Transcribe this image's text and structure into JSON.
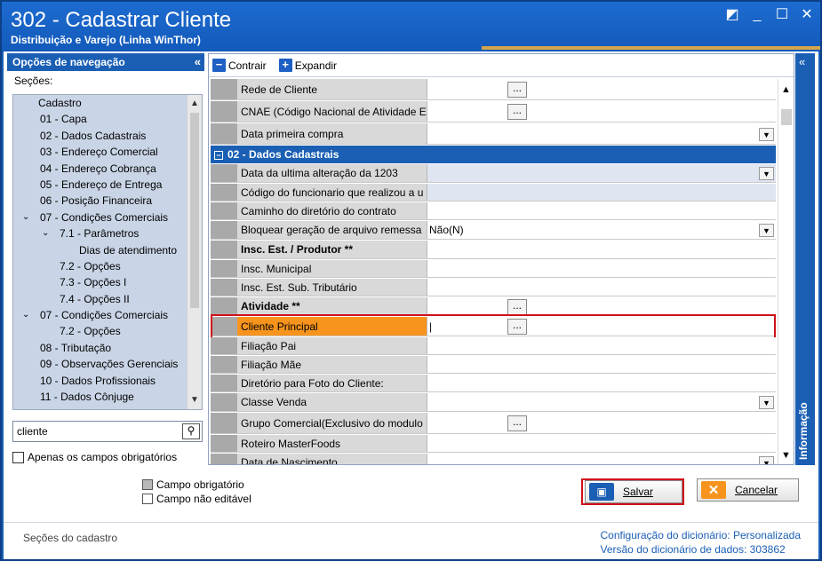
{
  "window": {
    "title": "302 - Cadastrar Cliente",
    "subtitle": "Distribuição e Varejo (Linha WinThor)"
  },
  "nav": {
    "header": "Opções de navegação",
    "collapse": "«",
    "sections_label": "Seções:",
    "items": [
      {
        "label": "Cadastro",
        "indent": 0,
        "expander": ""
      },
      {
        "label": "01 - Capa",
        "indent": 1,
        "expander": ""
      },
      {
        "label": "02 - Dados Cadastrais",
        "indent": 1,
        "expander": ""
      },
      {
        "label": "03 - Endereço Comercial",
        "indent": 1,
        "expander": ""
      },
      {
        "label": "04 - Endereço Cobrança",
        "indent": 1,
        "expander": ""
      },
      {
        "label": "05 - Endereço de Entrega",
        "indent": 1,
        "expander": ""
      },
      {
        "label": "06 - Posição Financeira",
        "indent": 1,
        "expander": ""
      },
      {
        "label": "07 - Condições Comerciais",
        "indent": 1,
        "expander": "v"
      },
      {
        "label": "7.1 - Parâmetros",
        "indent": 2,
        "expander": "v"
      },
      {
        "label": "Dias de atendimento",
        "indent": 3,
        "expander": ""
      },
      {
        "label": "7.2 - Opções",
        "indent": 2,
        "expander": ""
      },
      {
        "label": "7.3 - Opções I",
        "indent": 2,
        "expander": ""
      },
      {
        "label": "7.4 - Opções II",
        "indent": 2,
        "expander": ""
      },
      {
        "label": "07 - Condições Comerciais",
        "indent": 1,
        "expander": "v"
      },
      {
        "label": "7.2 - Opções",
        "indent": 2,
        "expander": ""
      },
      {
        "label": "08 - Tributação",
        "indent": 1,
        "expander": ""
      },
      {
        "label": "09 - Observações Gerenciais",
        "indent": 1,
        "expander": ""
      },
      {
        "label": "10 - Dados Profissionais",
        "indent": 1,
        "expander": ""
      },
      {
        "label": "11 - Dados Cônjuge",
        "indent": 1,
        "expander": ""
      }
    ],
    "search_value": "cliente",
    "only_required_label": "Apenas os campos obrigatórios"
  },
  "toolbar": {
    "collapse_label": "Contrair",
    "expand_label": "Expandir"
  },
  "grid": {
    "section_title": "02 - Dados Cadastrais",
    "rows_top": [
      {
        "label": "Rede de Cliente",
        "value": "",
        "ellipsis": true
      },
      {
        "label": "CNAE (Código Nacional de Atividade E",
        "value": "",
        "ellipsis": true
      },
      {
        "label": "Data primeira compra",
        "value": "",
        "dropdown": true
      }
    ],
    "rows": [
      {
        "label": "Data da ultima alteração da 1203",
        "value": "",
        "dropdown": true,
        "readonly": true
      },
      {
        "label": "Código do funcionario que realizou a u",
        "value": "",
        "readonly": true
      },
      {
        "label": "Caminho do diretório do contrato",
        "value": ""
      },
      {
        "label": "Bloquear geração de arquivo remessa",
        "value": "Não(N)",
        "dropdown": true
      },
      {
        "label": "Insc. Est. / Produtor **",
        "value": "",
        "bold": true
      },
      {
        "label": "Insc. Municipal",
        "value": ""
      },
      {
        "label": "Insc. Est. Sub. Tributário",
        "value": ""
      },
      {
        "label": "Atividade **",
        "value": "",
        "bold": true,
        "ellipsis": true
      },
      {
        "label": "Cliente Principal",
        "value": "",
        "ellipsis": true,
        "highlight": true
      },
      {
        "label": "Filiação Pai",
        "value": ""
      },
      {
        "label": "Filiação Mãe",
        "value": ""
      },
      {
        "label": "Diretório para Foto do Cliente:",
        "value": ""
      },
      {
        "label": "Classe Venda",
        "value": "",
        "dropdown": true
      },
      {
        "label": "Grupo Comercial(Exclusivo do modulo",
        "value": "",
        "ellipsis": true
      },
      {
        "label": "Roteiro MasterFoods",
        "value": ""
      },
      {
        "label": "Data de Nascimento",
        "value": "",
        "dropdown": true
      }
    ]
  },
  "info_panel": {
    "label": "Informação",
    "collapse": "«"
  },
  "legend": {
    "required": "Campo obrigatório",
    "readonly": "Campo não editável"
  },
  "buttons": {
    "save": "Salvar",
    "cancel": "Cancelar"
  },
  "status": {
    "left": "Seções do cadastro",
    "config_label": "Configuração do dicionário:",
    "config_value": "Personalizada",
    "version_label": "Versão do dicionário de dados:",
    "version_value": "303862"
  },
  "colors": {
    "brand": "#1a5fb4",
    "highlight": "#f7941d",
    "alert": "#d0101a"
  }
}
